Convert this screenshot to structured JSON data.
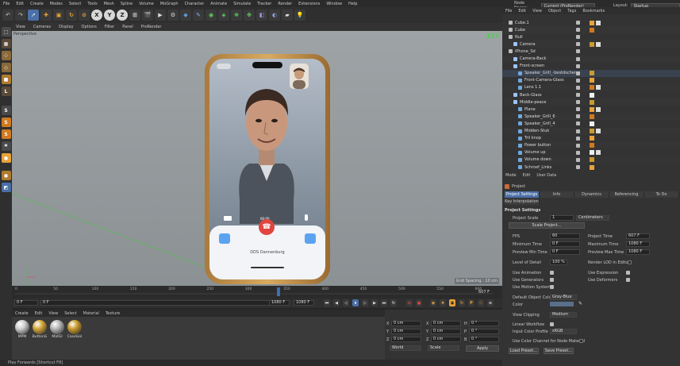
{
  "menubar": {
    "items": [
      "File",
      "Edit",
      "Create",
      "Modes",
      "Select",
      "Tools",
      "Mesh",
      "Spline",
      "Volume",
      "MoGraph",
      "Character",
      "Animate",
      "Simulate",
      "Tracker",
      "Render",
      "Extensions",
      "Window",
      "Help"
    ],
    "node_space_label": "Node Space:",
    "node_space_value": "Current (ProRender)",
    "layout_label": "Layout:",
    "layout_value": "Startup"
  },
  "viewport": {
    "menu": [
      "View",
      "Cameras",
      "Display",
      "Options",
      "Filter",
      "Panel",
      "ProRender"
    ],
    "title": "Perspective",
    "hud_value": "357",
    "grid_info": "Grid Spacing : 10 cm",
    "phone": {
      "call_status": "00:00",
      "caller_name": "DDS Dannenburg"
    }
  },
  "timeline": {
    "ticks": [
      "0",
      "50",
      "100",
      "150",
      "200",
      "250",
      "300",
      "350",
      "400",
      "450",
      "500",
      "550",
      "600"
    ],
    "current_frame": "0 F",
    "start_field": "0 F",
    "min_field": "0 F",
    "end_field": "1080 F",
    "max_field": "1080 F",
    "end_marker": "607 F"
  },
  "materials": {
    "menu": [
      "Create",
      "Edit",
      "View",
      "Select",
      "Material",
      "Texture"
    ],
    "items": [
      {
        "name": "MPM",
        "color": "#cfcfcf"
      },
      {
        "name": "ButtonG",
        "color": "#d4a73a"
      },
      {
        "name": "MatGl",
        "color": "#b8b8b8"
      },
      {
        "name": "CaseGol",
        "color": "#c99a2e"
      }
    ]
  },
  "coords": {
    "rows": [
      {
        "a": "X",
        "av": "0 cm",
        "b": "X",
        "bv": "0 cm",
        "c": "H",
        "cv": "0 °"
      },
      {
        "a": "Y",
        "av": "0 cm",
        "b": "Y",
        "bv": "0 cm",
        "c": "P",
        "cv": "0 °"
      },
      {
        "a": "Z",
        "av": "0 cm",
        "b": "Z",
        "bv": "0 cm",
        "c": "B",
        "cv": "0 °"
      }
    ],
    "world": "World",
    "scale": "Scale",
    "apply": "Apply"
  },
  "status_text": "Play Forwards [Shortcut F8]",
  "object_manager": {
    "menu": [
      "File",
      "Edit",
      "View",
      "Object",
      "Tags",
      "Bookmarks"
    ],
    "rows": [
      {
        "name": "Cube.1",
        "indent": 0
      },
      {
        "name": "Cube",
        "indent": 0
      },
      {
        "name": "Null",
        "indent": 0
      },
      {
        "name": "Camera",
        "indent": 1
      },
      {
        "name": "iPhone_Sd",
        "indent": 0
      },
      {
        "name": "Camera-Back",
        "indent": 1
      },
      {
        "name": "Front-screen",
        "indent": 1
      },
      {
        "name": "Speaker_Grill_-bestdscherm",
        "indent": 2
      },
      {
        "name": "Front-Camera-Glass",
        "indent": 2
      },
      {
        "name": "Lens 1.1",
        "indent": 2
      },
      {
        "name": "Back-Glass",
        "indent": 1
      },
      {
        "name": "Middle-peace",
        "indent": 1
      },
      {
        "name": "Plane",
        "indent": 2
      },
      {
        "name": "Speaker_Grill_6",
        "indent": 2
      },
      {
        "name": "Speaker_Grill_4",
        "indent": 2
      },
      {
        "name": "Midden-Stuk",
        "indent": 2
      },
      {
        "name": "Tril knop",
        "indent": 2
      },
      {
        "name": "Power button",
        "indent": 2
      },
      {
        "name": "Volume up",
        "indent": 2
      },
      {
        "name": "Volume down",
        "indent": 2
      },
      {
        "name": "Schroef_Links",
        "indent": 2
      }
    ]
  },
  "attributes": {
    "menu": [
      "Mode",
      "Edit",
      "User Data"
    ],
    "object": "Project",
    "tabs1": [
      "Project Settings",
      "Info",
      "Dynamics",
      "Referencing",
      "To Do"
    ],
    "tabs2": [
      "Key Interpolation"
    ],
    "section": "Project Settings",
    "project_scale_label": "Project Scale",
    "project_scale_value": "1",
    "project_scale_unit": "Centimeters",
    "scale_project_button": "Scale Project...",
    "fps_label": "FPS",
    "fps_value": "60",
    "project_time_label": "Project Time",
    "project_time_value": "607 F",
    "min_time_label": "Minimum Time",
    "min_time_value": "0 F",
    "max_time_label": "Maximum Time",
    "max_time_value": "1080 F",
    "prev_min_label": "Preview Min Time",
    "prev_min_value": "0 F",
    "prev_max_label": "Preview Max Time",
    "prev_max_value": "1080 F",
    "lod_label": "Level of Detail",
    "lod_value": "100 %",
    "render_lod_label": "Render LOD in Editor",
    "use_animation": "Use Animation",
    "use_expression": "Use Expression",
    "use_generators": "Use Generators",
    "use_deformers": "Use Deformers",
    "use_motion": "Use Motion System",
    "default_color_label": "Default Object Color",
    "default_color_value": "Gray-Blue",
    "color_label": "Color",
    "view_clipping_label": "View Clipping",
    "view_clipping_value": "Medium",
    "linear_workflow": "Linear Workflow",
    "input_color_label": "Input Color Profile",
    "input_color_value": "sRGB",
    "color_channel": "Use Color Channel for Node Material",
    "load_preset": "Load Preset...",
    "save_preset": "Save Preset..."
  }
}
